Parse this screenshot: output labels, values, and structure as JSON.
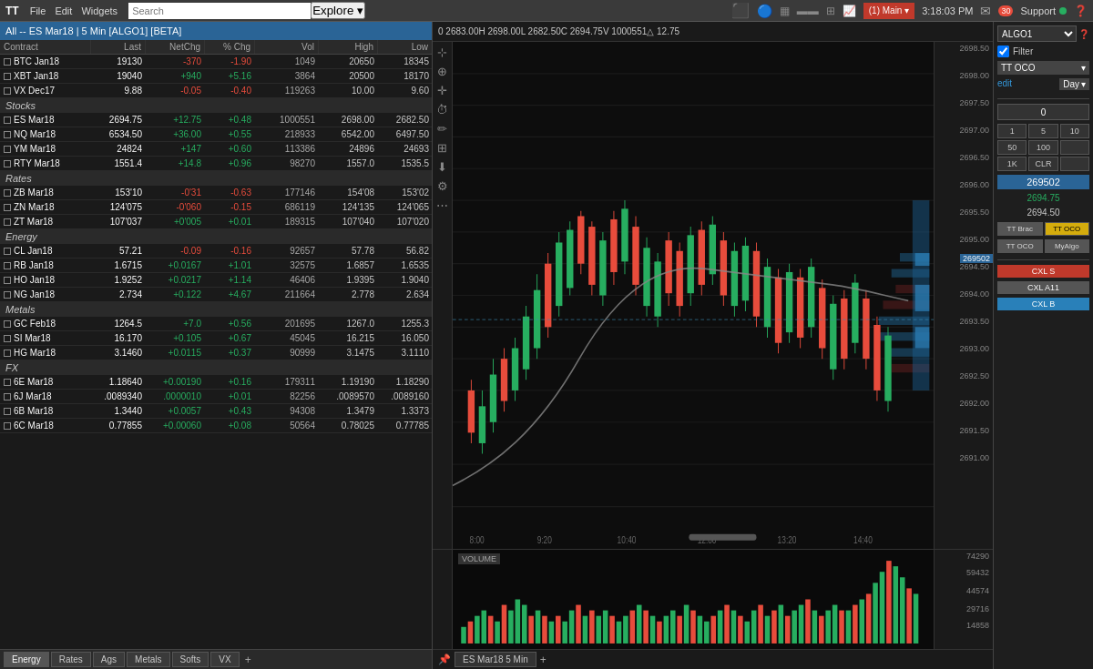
{
  "menubar": {
    "logo": "TT",
    "menus": [
      "File",
      "Edit",
      "Widgets"
    ],
    "search_placeholder": "Search",
    "explore_label": "Explore ▾",
    "workspace_label": "(1) Main ▾",
    "time": "3:18:03 PM",
    "support_label": "Support",
    "notifications": "30"
  },
  "panel_title": "All -- ES Mar18 | 5 Min [ALGO1] [BETA]",
  "table_headers": [
    "Contract",
    "Last",
    "NetChg",
    "% Chg",
    "Vol",
    "High",
    "Low"
  ],
  "sections": [
    {
      "name": "",
      "rows": [
        {
          "contract": "BTC Jan18",
          "last": "19130",
          "netchg": "-370",
          "pctchg": "-1.90",
          "vol": "1049",
          "high": "20650",
          "low": "18345",
          "chg_color": "red"
        },
        {
          "contract": "XBT Jan18",
          "last": "19040",
          "netchg": "+940",
          "pctchg": "+5.16",
          "vol": "3864",
          "high": "20500",
          "low": "18170",
          "chg_color": "green"
        },
        {
          "contract": "VX Dec17",
          "last": "9.88",
          "netchg": "-0.05",
          "pctchg": "-0.40",
          "vol": "119263",
          "high": "10.00",
          "low": "9.60",
          "chg_color": "red"
        }
      ]
    },
    {
      "name": "Stocks",
      "rows": [
        {
          "contract": "ES Mar18",
          "last": "2694.75",
          "netchg": "+12.75",
          "pctchg": "+0.48",
          "vol": "1000551",
          "high": "2698.00",
          "low": "2682.50",
          "chg_color": "green"
        },
        {
          "contract": "NQ Mar18",
          "last": "6534.50",
          "netchg": "+36.00",
          "pctchg": "+0.55",
          "vol": "218933",
          "high": "6542.00",
          "low": "6497.50",
          "chg_color": "green"
        },
        {
          "contract": "YM Mar18",
          "last": "24824",
          "netchg": "+147",
          "pctchg": "+0.60",
          "vol": "113386",
          "high": "24896",
          "low": "24693",
          "chg_color": "green"
        },
        {
          "contract": "RTY Mar18",
          "last": "1551.4",
          "netchg": "+14.8",
          "pctchg": "+0.96",
          "vol": "98270",
          "high": "1557.0",
          "low": "1535.5",
          "chg_color": "green"
        }
      ]
    },
    {
      "name": "Rates",
      "rows": [
        {
          "contract": "ZB Mar18",
          "last": "153'10",
          "netchg": "-0'31",
          "pctchg": "-0.63",
          "vol": "177146",
          "high": "154'08",
          "low": "153'02",
          "chg_color": "red"
        },
        {
          "contract": "ZN Mar18",
          "last": "124'075",
          "netchg": "-0'060",
          "pctchg": "-0.15",
          "vol": "686119",
          "high": "124'135",
          "low": "124'065",
          "chg_color": "red"
        },
        {
          "contract": "ZT Mar18",
          "last": "107'037",
          "netchg": "+0'005",
          "pctchg": "+0.01",
          "vol": "189315",
          "high": "107'040",
          "low": "107'020",
          "chg_color": "green"
        }
      ]
    },
    {
      "name": "Energy",
      "rows": [
        {
          "contract": "CL Jan18",
          "last": "57.21",
          "netchg": "-0.09",
          "pctchg": "-0.16",
          "vol": "92657",
          "high": "57.78",
          "low": "56.82",
          "chg_color": "red"
        },
        {
          "contract": "RB Jan18",
          "last": "1.6715",
          "netchg": "+0.0167",
          "pctchg": "+1.01",
          "vol": "32575",
          "high": "1.6857",
          "low": "1.6535",
          "chg_color": "green"
        },
        {
          "contract": "HO Jan18",
          "last": "1.9252",
          "netchg": "+0.0217",
          "pctchg": "+1.14",
          "vol": "46406",
          "high": "1.9395",
          "low": "1.9040",
          "chg_color": "green"
        },
        {
          "contract": "NG Jan18",
          "last": "2.734",
          "netchg": "+0.122",
          "pctchg": "+4.67",
          "vol": "211664",
          "high": "2.778",
          "low": "2.634",
          "chg_color": "green"
        }
      ]
    },
    {
      "name": "Metals",
      "rows": [
        {
          "contract": "GC Feb18",
          "last": "1264.5",
          "netchg": "+7.0",
          "pctchg": "+0.56",
          "vol": "201695",
          "high": "1267.0",
          "low": "1255.3",
          "chg_color": "green"
        },
        {
          "contract": "SI Mar18",
          "last": "16.170",
          "netchg": "+0.105",
          "pctchg": "+0.67",
          "vol": "45045",
          "high": "16.215",
          "low": "16.050",
          "chg_color": "green"
        },
        {
          "contract": "HG Mar18",
          "last": "3.1460",
          "netchg": "+0.0115",
          "pctchg": "+0.37",
          "vol": "90999",
          "high": "3.1475",
          "low": "3.1110",
          "chg_color": "green"
        }
      ]
    },
    {
      "name": "FX",
      "rows": [
        {
          "contract": "6E Mar18",
          "last": "1.18640",
          "netchg": "+0.00190",
          "pctchg": "+0.16",
          "vol": "179311",
          "high": "1.19190",
          "low": "1.18290",
          "chg_color": "green"
        },
        {
          "contract": "6J Mar18",
          "last": ".0089340",
          "netchg": ".0000010",
          "pctchg": "+0.01",
          "vol": "82256",
          "high": ".0089570",
          "low": ".0089160",
          "chg_color": "green"
        },
        {
          "contract": "6B Mar18",
          "last": "1.3440",
          "netchg": "+0.0057",
          "pctchg": "+0.43",
          "vol": "94308",
          "high": "1.3479",
          "low": "1.3373",
          "chg_color": "green"
        },
        {
          "contract": "6C Mar18",
          "last": "0.77855",
          "netchg": "+0.00060",
          "pctchg": "+0.08",
          "vol": "50564",
          "high": "0.78025",
          "low": "0.77785",
          "chg_color": "green"
        }
      ]
    }
  ],
  "bottom_tabs": [
    "Energy",
    "Rates",
    "Ags",
    "Metals",
    "Softs",
    "VX"
  ],
  "chart": {
    "ohlcv": "0  2683.00H  2698.00L  2682.50C  2694.75V  1000551△  12.75",
    "price_levels": [
      "2698.50",
      "2698.00",
      "2697.50",
      "2697.00",
      "2696.50",
      "2696.00",
      "2695.50",
      "2695.00",
      "2694.50",
      "2694.00",
      "2693.50",
      "2693.00",
      "2692.50",
      "2692.00",
      "2691.50",
      "2691.00"
    ],
    "time_labels": [
      "8:00",
      "9:20",
      "10:40",
      "12:00",
      "13:20",
      "14:40"
    ],
    "volume_label": "VOLUME",
    "volume_scale": [
      "74290",
      "59432",
      "44574",
      "29716",
      "14858"
    ]
  },
  "order_panel": {
    "algo_label": "ALGO1",
    "filter_label": "Filter",
    "order_type": "TT OCO",
    "edit_label": "edit",
    "time_label": "Day",
    "price_value": "0",
    "price_display": "2694.75",
    "bid_display": "2694.50",
    "qty_buttons": [
      "1",
      "5",
      "10",
      "50",
      "100",
      "1K",
      "CLR"
    ],
    "tt_brac_label": "TT Brac",
    "tt_oco_label": "TT OCO",
    "tt_oco_active": "TT OCO",
    "my_algo_label": "MyAlgo",
    "order_price": "269502",
    "cxl_s_label": "CXL S",
    "cxl_all_label": "CXL A11",
    "cxl_b_label": "CXL B"
  },
  "chart_tabs": [
    "ES Mar18 5 Min"
  ],
  "icons": {
    "cursor": "⊹",
    "zoom": "⊕",
    "crosshair": "⊕",
    "clock": "⏱",
    "draw": "✏",
    "layers": "⊞",
    "download": "⬇",
    "settings": "⚙",
    "more": "⋯"
  }
}
